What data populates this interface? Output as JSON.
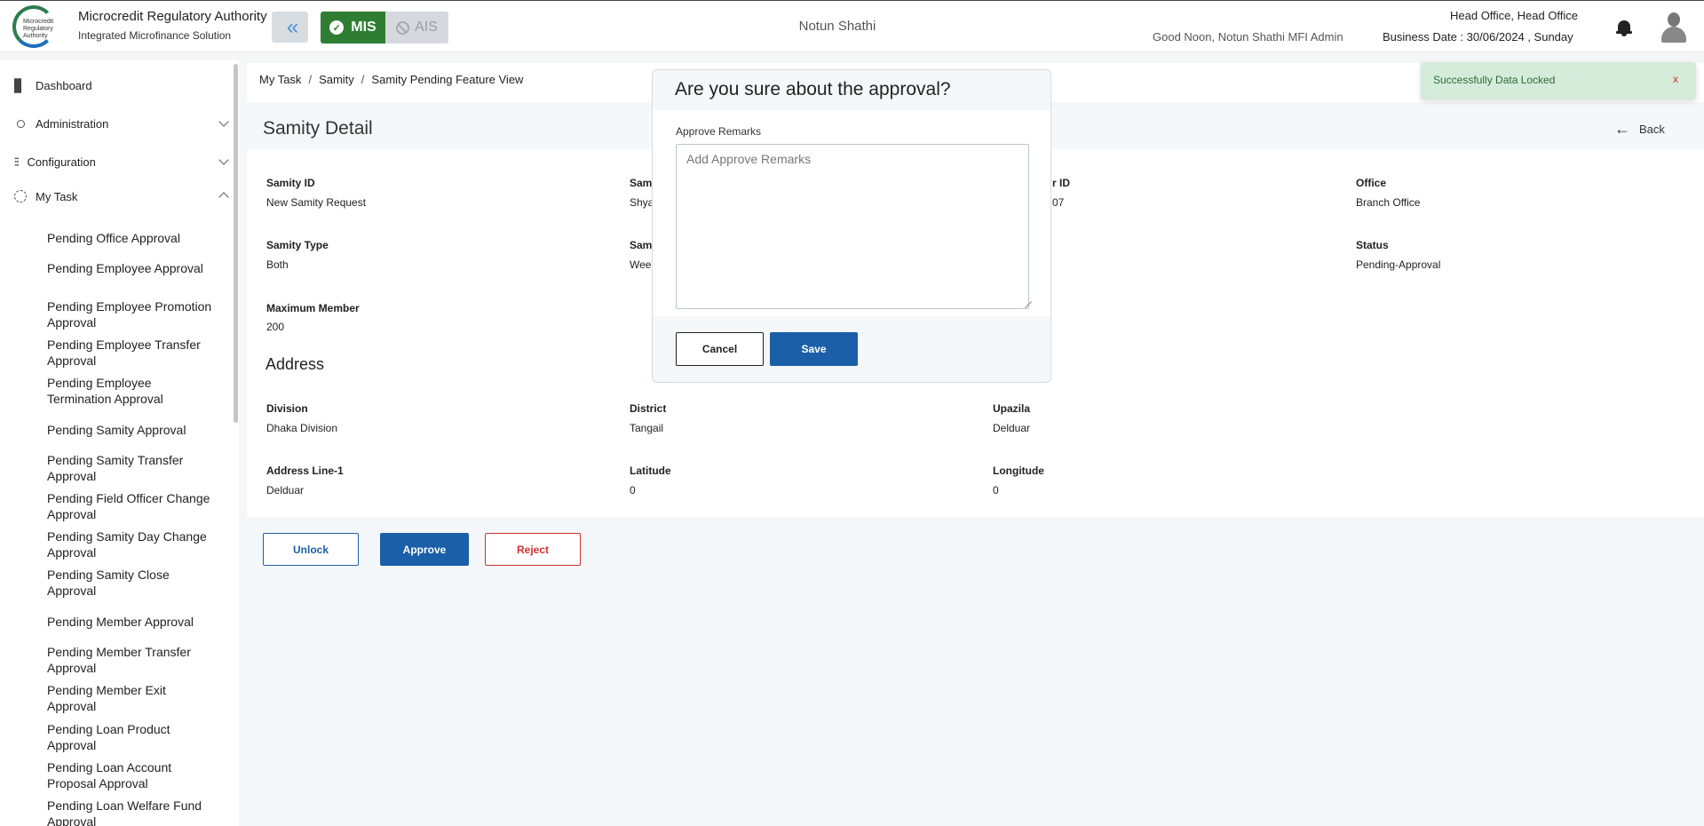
{
  "header": {
    "org_name": "Microcredit Regulatory Authority",
    "org_subtitle": "Integrated Microfinance Solution",
    "logo_text": "Microcredit Regulatory Authority",
    "module_mis": "MIS",
    "module_ais": "AIS",
    "center_title": "Notun Shathi",
    "greeting": "Good Noon, Notun Shathi MFI Admin",
    "office": "Head Office, Head Office",
    "business_date": "Business Date : 30/06/2024 , Sunday"
  },
  "sidebar": {
    "main": [
      {
        "label": "Dashboard",
        "icon": "grid-icon"
      },
      {
        "label": "Administration",
        "icon": "users-icon"
      },
      {
        "label": "Configuration",
        "icon": "sliders-icon"
      },
      {
        "label": "My Task",
        "icon": "task-icon"
      }
    ],
    "sub_items": [
      "Pending Office Approval",
      "Pending Employee Approval",
      "Pending Employee Promotion Approval",
      "Pending Employee Transfer Approval",
      "Pending Employee Termination Approval",
      "Pending Samity Approval",
      "Pending Samity Transfer Approval",
      "Pending Field Officer Change Approval",
      "Pending Samity Day Change Approval",
      "Pending Samity Close Approval",
      "Pending Member Approval",
      "Pending Member Transfer Approval",
      "Pending Member Exit Approval",
      "Pending Loan Product Approval",
      "Pending Loan Account Proposal Approval",
      "Pending Loan Welfare Fund Approval"
    ]
  },
  "breadcrumb": [
    "My Task",
    "Samity",
    "Samity Pending Feature View"
  ],
  "detail": {
    "title": "Samity Detail",
    "back_label": "Back",
    "fields": {
      "samity_id_label": "Samity ID",
      "samity_id_value": "New Samity Request",
      "samity_name_label": "Sam",
      "samity_name_value": "Shya",
      "field_officer_label": "r ID",
      "field_officer_value": "07",
      "office_label": "Office",
      "office_value": "Branch Office",
      "samity_type_label": "Samity Type",
      "samity_type_value": "Both",
      "samity_day_label": "Sam",
      "samity_day_value": "Week",
      "status_label": "Status",
      "status_value": "Pending-Approval",
      "max_member_label": "Maximum Member",
      "max_member_value": "200"
    },
    "address_title": "Address",
    "address": {
      "division_label": "Division",
      "division_value": "Dhaka Division",
      "district_label": "District",
      "district_value": "Tangail",
      "upazila_label": "Upazila",
      "upazila_value": "Delduar",
      "line1_label": "Address Line-1",
      "line1_value": "Delduar",
      "latitude_label": "Latitude",
      "latitude_value": "0",
      "longitude_label": "Longitude",
      "longitude_value": "0"
    },
    "buttons": {
      "unlock": "Unlock",
      "approve": "Approve",
      "reject": "Reject"
    }
  },
  "modal": {
    "title": "Are you sure about the approval?",
    "remarks_label": "Approve Remarks",
    "remarks_value": "",
    "remarks_placeholder": "Add Approve Remarks",
    "cancel_label": "Cancel",
    "save_label": "Save"
  },
  "toast": {
    "message": "Successfully Data Locked",
    "close": "x"
  },
  "colors": {
    "primary": "#1a5fa8",
    "mis_green": "#2e7d32",
    "danger": "#d32f2f",
    "toast_bg": "#d4ecd9"
  }
}
